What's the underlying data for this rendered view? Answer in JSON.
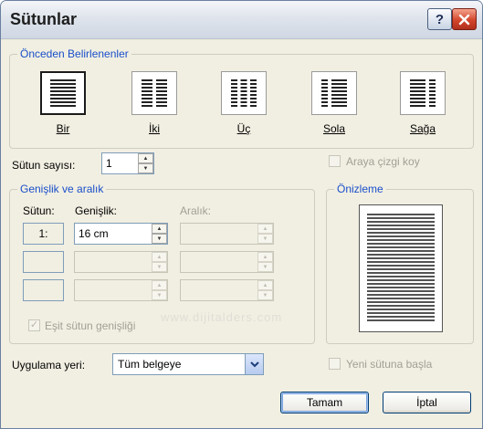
{
  "dialog": {
    "title": "Sütunlar",
    "help_glyph": "?"
  },
  "presets": {
    "group_label": "Önceden Belirlenenler",
    "items": [
      {
        "label": "Bir"
      },
      {
        "label": "İki"
      },
      {
        "label": "Üç"
      },
      {
        "label": "Sola"
      },
      {
        "label": "Sağa"
      }
    ]
  },
  "column_count": {
    "label": "Sütun sayısı:",
    "value": "1"
  },
  "line_between": {
    "label": "Araya çizgi koy",
    "checked": false
  },
  "width_spacing": {
    "group_label": "Genişlik ve aralık",
    "col_header": "Sütun:",
    "width_header": "Genişlik:",
    "spacing_header": "Aralık:",
    "rows": [
      {
        "col": "1:",
        "width": "16 cm",
        "spacing": ""
      },
      {
        "col": "",
        "width": "",
        "spacing": ""
      },
      {
        "col": "",
        "width": "",
        "spacing": ""
      }
    ],
    "equal_width_label": "Eşit sütun genişliği",
    "equal_width_checked": true
  },
  "preview": {
    "group_label": "Önizleme"
  },
  "apply_to": {
    "label": "Uygulama yeri:",
    "value": "Tüm belgeye"
  },
  "start_new_column": {
    "label": "Yeni sütuna başla",
    "checked": false
  },
  "buttons": {
    "ok": "Tamam",
    "cancel": "İptal"
  },
  "watermark": "www.dijitalders.com",
  "colors": {
    "group_label": "#1a4fc9",
    "disabled_text": "#a2a096",
    "dialog_bg": "#f1efe2"
  }
}
